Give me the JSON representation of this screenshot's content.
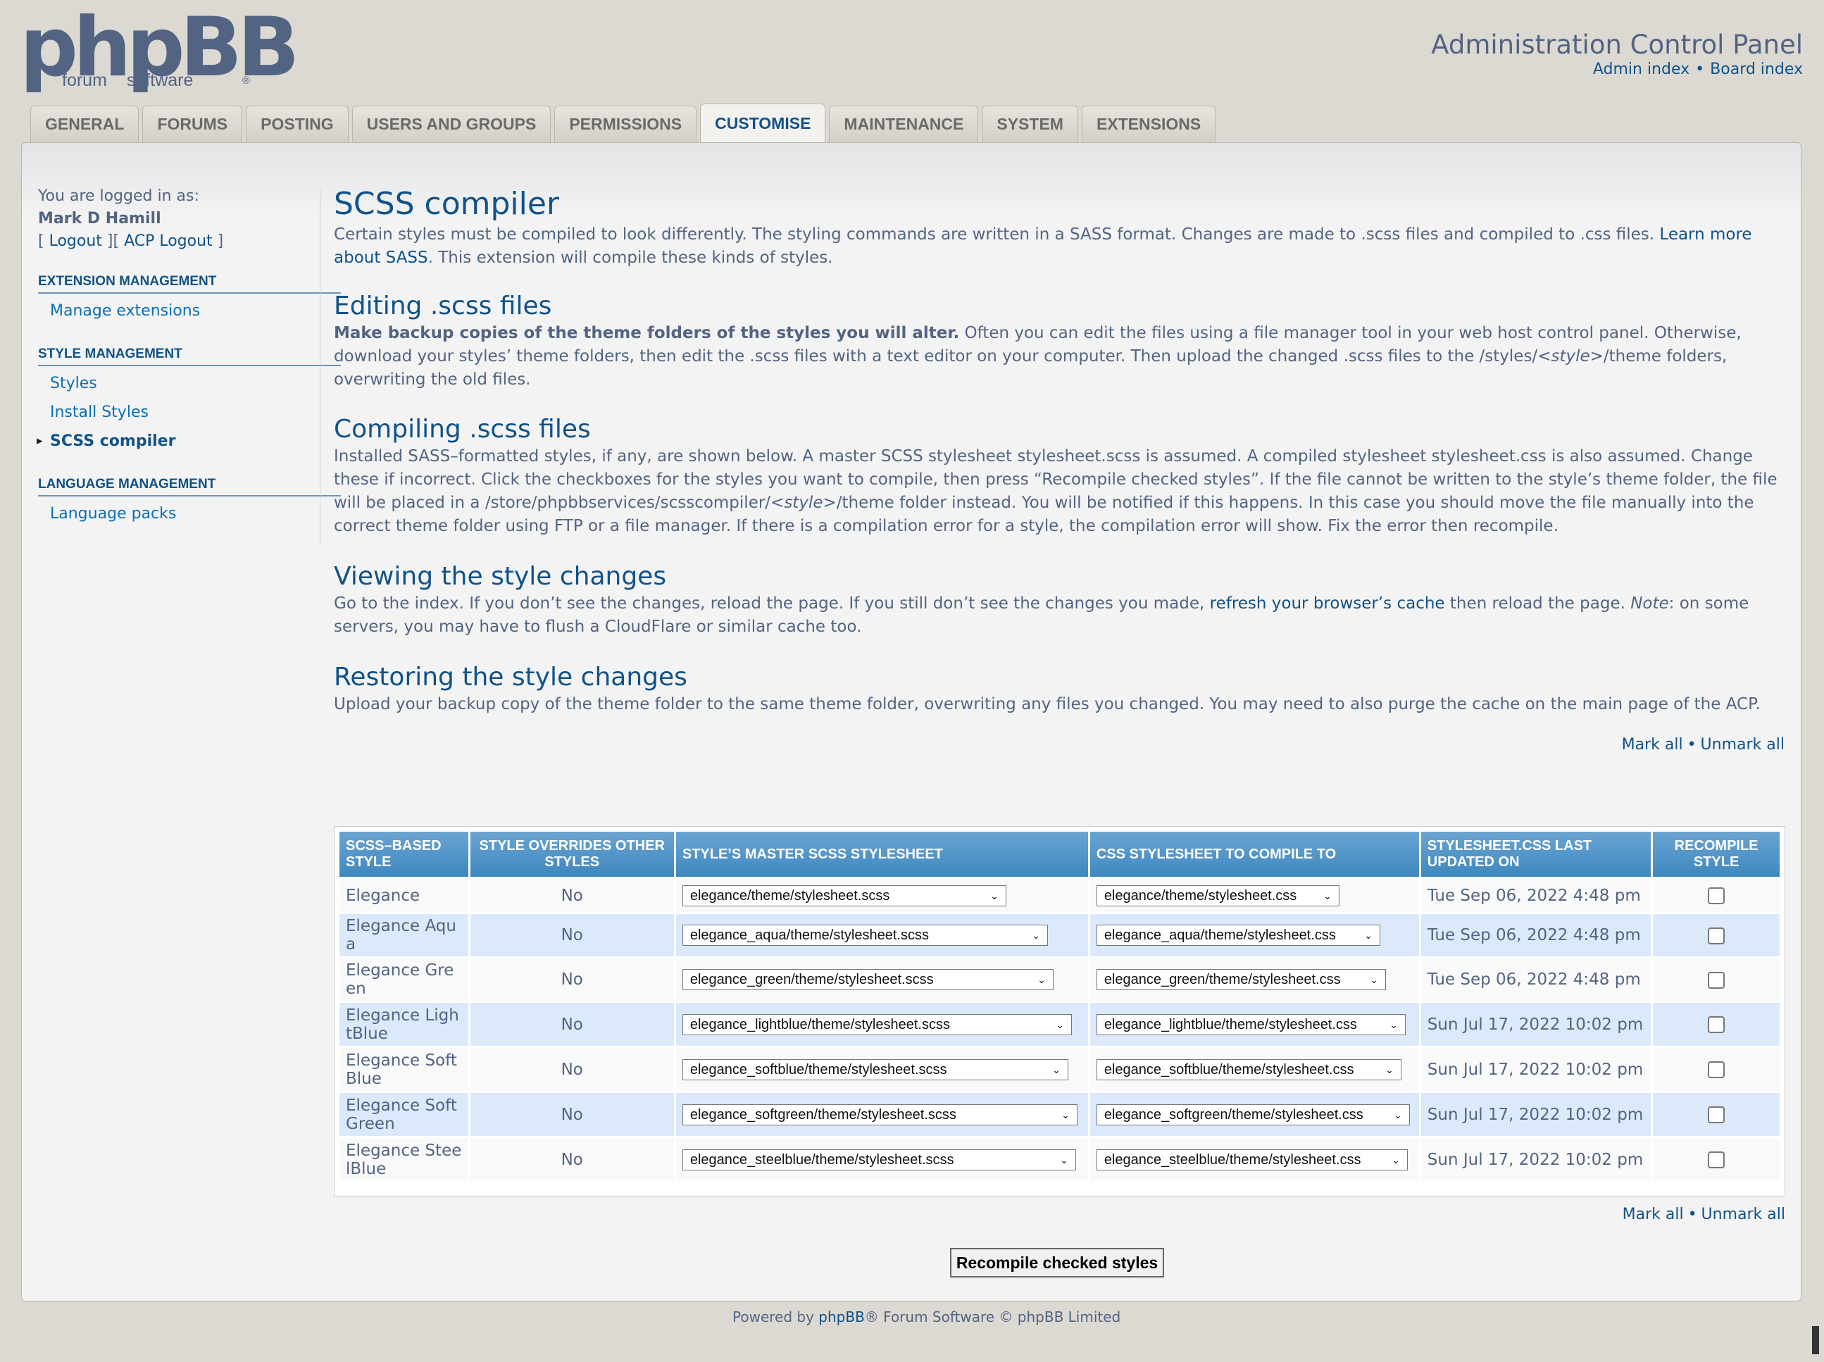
{
  "logo": {
    "main": "phpBB",
    "sub_left": "forum",
    "sub_right": "software",
    "reg": "®"
  },
  "header": {
    "title": "Administration Control Panel",
    "admin_index": "Admin index",
    "separator": "•",
    "board_index": "Board index"
  },
  "tabs": [
    "GENERAL",
    "FORUMS",
    "POSTING",
    "USERS AND GROUPS",
    "PERMISSIONS",
    "CUSTOMISE",
    "MAINTENANCE",
    "SYSTEM",
    "EXTENSIONS"
  ],
  "active_tab": "CUSTOMISE",
  "sidebar": {
    "logged_in_label": "You are logged in as:",
    "username": "Mark D Hamill",
    "logout": "Logout",
    "acp_logout": "ACP Logout",
    "sections": [
      {
        "title": "EXTENSION MANAGEMENT",
        "items": [
          {
            "label": "Manage extensions"
          }
        ]
      },
      {
        "title": "STYLE MANAGEMENT",
        "items": [
          {
            "label": "Styles"
          },
          {
            "label": "Install Styles"
          },
          {
            "label": "SCSS compiler"
          }
        ]
      },
      {
        "title": "LANGUAGE MANAGEMENT",
        "items": [
          {
            "label": "Language packs"
          }
        ]
      }
    ],
    "active_item": "SCSS compiler"
  },
  "content": {
    "title": "SCSS compiler",
    "intro_text": "Certain styles must be compiled to look differently. The styling commands are written in a SASS format. Changes are made to .scss files and compiled to .css files. ",
    "intro_link": "Learn more about SASS",
    "intro_tail": ". This extension will compile these kinds of styles.",
    "editing_title": "Editing .scss files",
    "editing_bold": "Make backup copies of the theme folders of the styles you will alter.",
    "editing_text": " Often you can edit the files using a file manager tool in your web host control panel. Otherwise, download your styles’ theme folders, then edit the .scss files with a text editor on your computer. Then upload the changed .scss files to the /styles/",
    "editing_style": "<style>",
    "editing_tail": "/theme folders, overwriting the old files.",
    "compiling_title": "Compiling .scss files",
    "compiling_text": "Installed SASS–formatted styles, if any, are shown below. A master SCSS stylesheet stylesheet.scss is assumed. A compiled stylesheet stylesheet.css is also assumed. Change these if incorrect. Click the checkboxes for the styles you want to compile, then press “Recompile checked styles”. If the file cannot be written to the style’s theme folder, the file will be placed in a /store/phpbbservices/scsscompiler/",
    "compiling_style": "<style>",
    "compiling_tail": "/theme folder instead. You will be notified if this happens. In this case you should move the file manually into the correct theme folder using FTP or a file manager. If there is a compilation error for a style, the compilation error will show. Fix the error then recompile.",
    "viewing_title": "Viewing the style changes",
    "viewing_text": "Go to the index. If you don’t see the changes, reload the page. If you still don’t see the changes you made, ",
    "viewing_link": "refresh your browser’s cache",
    "viewing_mid": " then reload the page. ",
    "viewing_note": "Note",
    "viewing_tail": ": on some servers, you may have to flush a CloudFlare or similar cache too.",
    "restoring_title": "Restoring the style changes",
    "restoring_text": "Upload your backup copy of the theme folder to the same theme folder, overwriting any files you changed. You may need to also purge the cache on the main page of the ACP."
  },
  "mark_all": "Mark all",
  "unmark_all": "Unmark all",
  "bullet": "•",
  "table": {
    "headers": [
      "SCSS–BASED STYLE",
      "STYLE OVERRIDES OTHER STYLES",
      "STYLE’S MASTER SCSS STYLESHEET",
      "CSS STYLESHEET TO COMPILE TO",
      "STYLESHEET.CSS LAST UPDATED ON",
      "RECOMPILE STYLE"
    ],
    "rows": [
      {
        "style": "Elegance",
        "overrides": "No",
        "scss": "elegance/theme/stylesheet.scss",
        "css": "elegance/theme/stylesheet.css",
        "updated": "Tue Sep 06, 2022 4:48 pm"
      },
      {
        "style": "Elegance Aqua",
        "overrides": "No",
        "scss": "elegance_aqua/theme/stylesheet.scss",
        "css": "elegance_aqua/theme/stylesheet.css",
        "updated": "Tue Sep 06, 2022 4:48 pm"
      },
      {
        "style": "Elegance Green",
        "overrides": "No",
        "scss": "elegance_green/theme/stylesheet.scss",
        "css": "elegance_green/theme/stylesheet.css",
        "updated": "Tue Sep 06, 2022 4:48 pm"
      },
      {
        "style": "Elegance LightBlue",
        "overrides": "No",
        "scss": "elegance_lightblue/theme/stylesheet.scss",
        "css": "elegance_lightblue/theme/stylesheet.css",
        "updated": "Sun Jul 17, 2022 10:02 pm"
      },
      {
        "style": "Elegance SoftBlue",
        "overrides": "No",
        "scss": "elegance_softblue/theme/stylesheet.scss",
        "css": "elegance_softblue/theme/stylesheet.css",
        "updated": "Sun Jul 17, 2022 10:02 pm"
      },
      {
        "style": "Elegance SoftGreen",
        "overrides": "No",
        "scss": "elegance_softgreen/theme/stylesheet.scss",
        "css": "elegance_softgreen/theme/stylesheet.css",
        "updated": "Sun Jul 17, 2022 10:02 pm"
      },
      {
        "style": "Elegance SteelBlue",
        "overrides": "No",
        "scss": "elegance_steelblue/theme/stylesheet.scss",
        "css": "elegance_steelblue/theme/stylesheet.css",
        "updated": "Sun Jul 17, 2022 10:02 pm"
      }
    ]
  },
  "recompile_button": "Recompile checked styles",
  "footer": {
    "prefix": "Powered by ",
    "brand": "phpBB",
    "suffix": "® Forum Software © phpBB Limited"
  },
  "colors": {
    "link": "#105289",
    "text": "#536482",
    "header_bg": "#4a8fc5",
    "row_alt": "#dbe9fb",
    "page_bg": "#dcd9d2"
  }
}
